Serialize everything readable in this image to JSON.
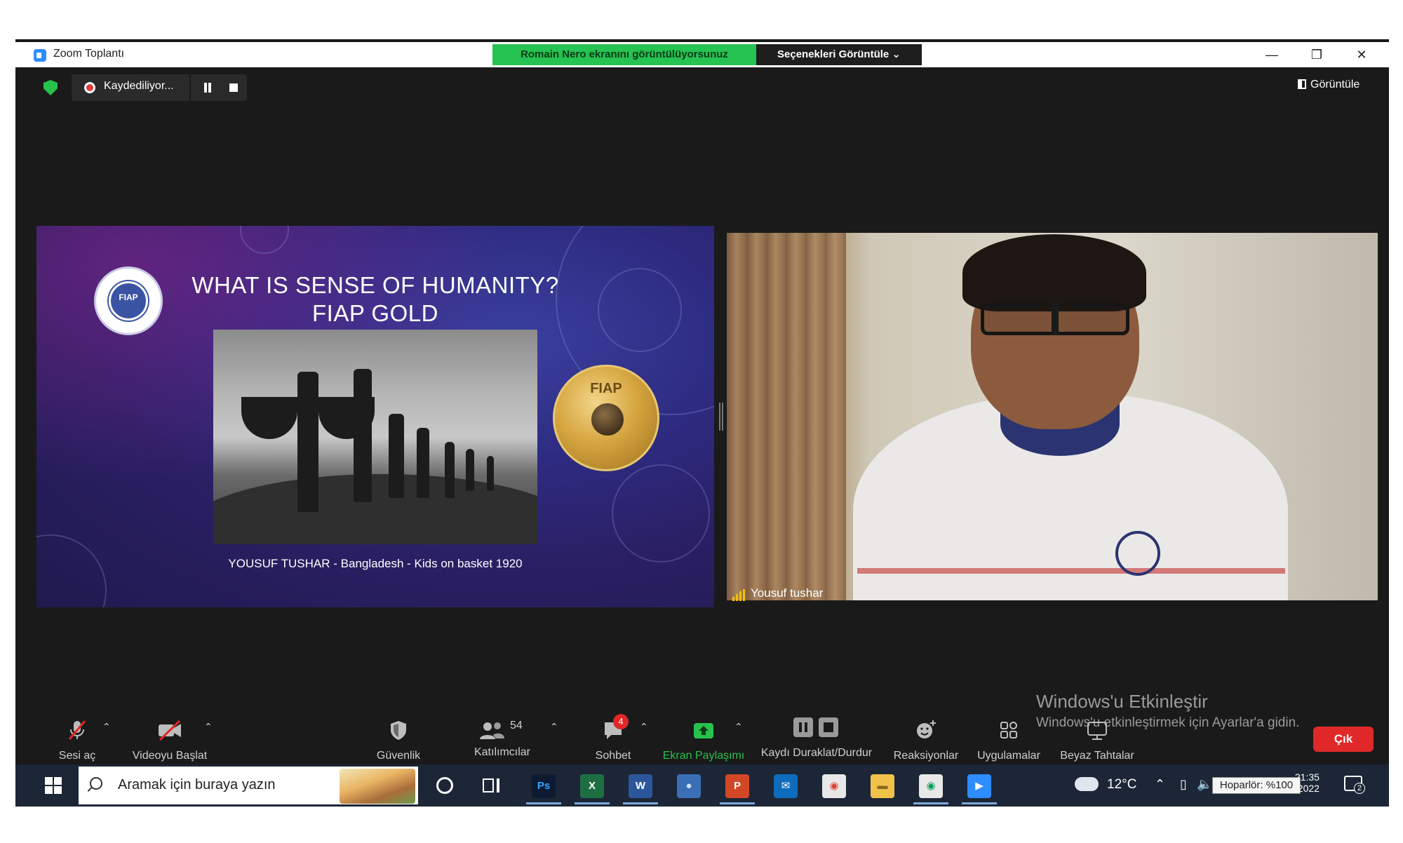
{
  "window": {
    "title": "Zoom Toplantı",
    "share_banner": "Romain Nero ekranını görüntülüyorsunuz",
    "options_label": "Seçenekleri Görüntüle ⌄",
    "minimize": "—",
    "restore": "❐",
    "close": "✕"
  },
  "meeting": {
    "recording_label": "Kaydediliyor...",
    "view_label": "Görüntüle"
  },
  "slide": {
    "title_line1": "WHAT IS SENSE OF HUMANITY?",
    "title_line2": "FIAP GOLD",
    "seal_text": "FIAP",
    "medal_text": "FIAP",
    "caption": "YOUSUF TUSHAR - Bangladesh - Kids on basket 1920"
  },
  "video": {
    "participant_name": "Yousuf tushar"
  },
  "activation": {
    "title": "Windows'u Etkinleştir",
    "subtitle": "Windows'u etkinleştirmek için Ayarlar'a gidin."
  },
  "toolbar": {
    "mute_label": "Sesi aç",
    "video_label": "Videoyu Başlat",
    "security_label": "Güvenlik",
    "participants_label": "Katılımcılar",
    "participants_count": "54",
    "chat_label": "Sohbet",
    "chat_badge": "4",
    "share_label": "Ekran Paylaşımı",
    "record_label": "Kaydı Duraklat/Durdur",
    "reactions_label": "Reaksiyonlar",
    "apps_label": "Uygulamalar",
    "whiteboard_label": "Beyaz Tahtalar",
    "leave_label": "Çık"
  },
  "taskbar": {
    "search_placeholder": "Aramak için buraya yazın",
    "apps": [
      {
        "name": "Ps",
        "color": "#0d1a33",
        "fg": "#31a8ff"
      },
      {
        "name": "X",
        "color": "#1d6f42",
        "fg": "#ffffff"
      },
      {
        "name": "W",
        "color": "#2b579a",
        "fg": "#ffffff"
      },
      {
        "name": "●",
        "color": "#3a6fb5",
        "fg": "#cfe3ff"
      },
      {
        "name": "P",
        "color": "#d24726",
        "fg": "#ffffff"
      },
      {
        "name": "✉",
        "color": "#0f6cbd",
        "fg": "#ffffff"
      },
      {
        "name": "◉",
        "color": "#e8e8e8",
        "fg": "#db4437"
      },
      {
        "name": "▬",
        "color": "#f0c24a",
        "fg": "#8a6a1a"
      },
      {
        "name": "◉",
        "color": "#e8e8e8",
        "fg": "#0f9d58"
      },
      {
        "name": "▶",
        "color": "#2d8cff",
        "fg": "#ffffff"
      }
    ],
    "temperature": "12°C",
    "volume_tooltip": "Hoparlör: %100",
    "time": "21:35",
    "date": "..2022",
    "notification_count": "2"
  }
}
